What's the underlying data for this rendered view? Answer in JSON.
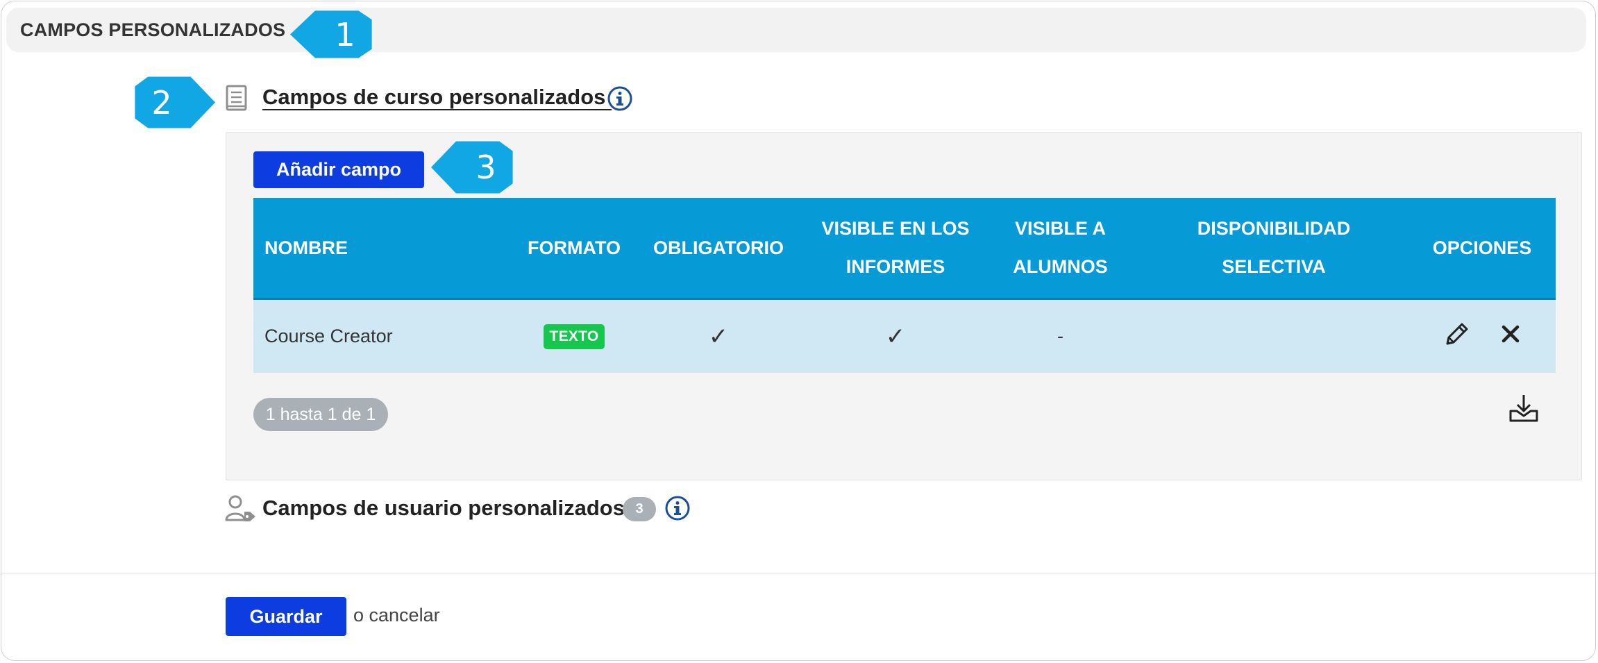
{
  "section": {
    "title": "CAMPOS PERSONALIZADOS"
  },
  "callouts": [
    "1",
    "2",
    "3"
  ],
  "course_fields": {
    "title": "Campos de curso personalizados ",
    "add_button_label": "Añadir campo",
    "table": {
      "columns": [
        "NOMBRE",
        "FORMATO",
        "OBLIGATORIO",
        "VISIBLE EN LOS INFORMES",
        "VISIBLE A ALUMNOS",
        "DISPONIBILIDAD SELECTIVA",
        "OPCIONES"
      ],
      "rows": [
        {
          "name": "Course Creator",
          "format": "TEXTO",
          "required": "✓",
          "visible_reports": "✓",
          "visible_students": "-",
          "selective_availability": ""
        }
      ]
    },
    "pagination": "1 hasta 1 de 1"
  },
  "user_fields": {
    "title": "Campos de usuario personalizados",
    "count": "3"
  },
  "footer": {
    "save_label": "Guardar",
    "cancel_text": "o cancelar"
  },
  "colors": {
    "callout": "#11a6e4",
    "primary_button": "#0d3ce0",
    "table_header": "#069ad6",
    "table_row": "#cfe8f3",
    "format_badge": "#15c74d",
    "info_icon": "#1a4f97"
  },
  "icons": {
    "course_fields": "book-icon",
    "info": "info-icon",
    "edit": "pencil-icon",
    "delete": "close-icon",
    "export": "download-icon",
    "user_fields": "user-tag-icon"
  }
}
